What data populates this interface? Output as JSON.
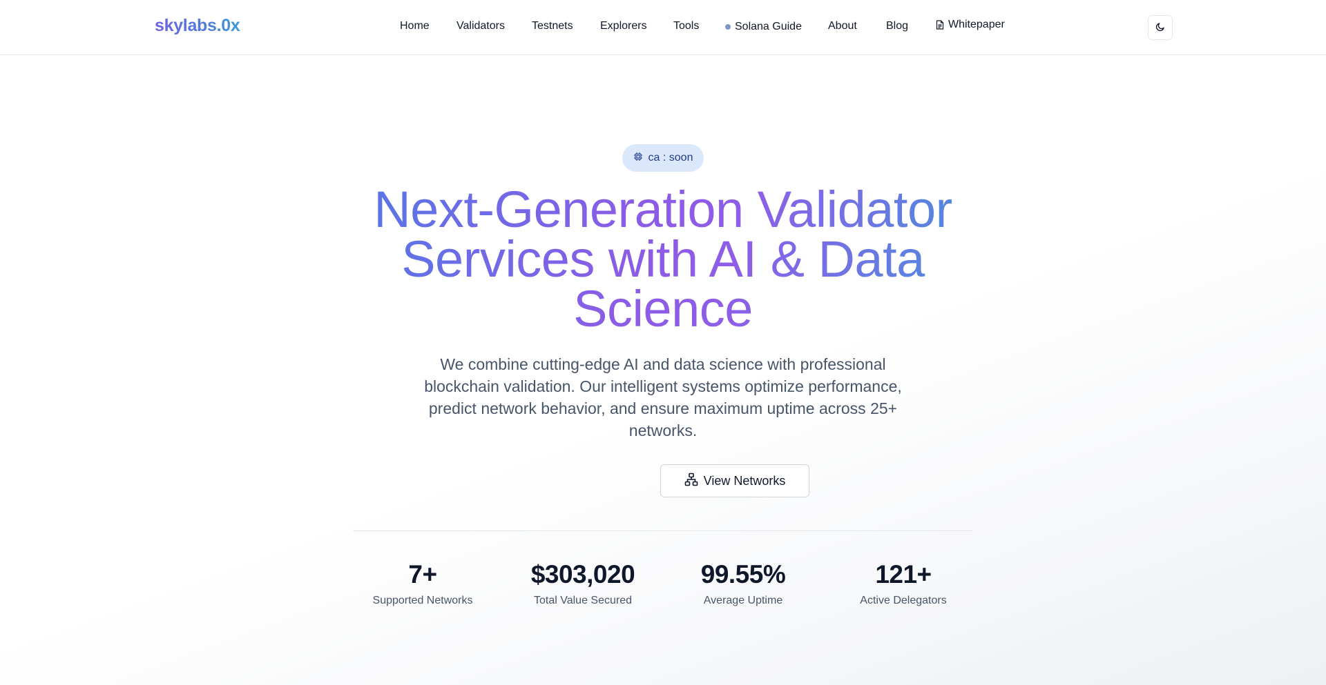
{
  "header": {
    "logo": "skylabs.0x",
    "nav": [
      {
        "label": "Home"
      },
      {
        "label": "Validators"
      },
      {
        "label": "Testnets"
      },
      {
        "label": "Explorers"
      },
      {
        "label": "Tools"
      },
      {
        "label": "Solana Guide",
        "icon": "status-dot"
      },
      {
        "label": "About"
      },
      {
        "label": "Blog"
      },
      {
        "label": "Whitepaper",
        "icon": "document-icon"
      }
    ],
    "theme_toggle_icon": "moon-icon"
  },
  "hero": {
    "badge": {
      "icon": "cpu-chip-icon",
      "text": "ca : soon"
    },
    "title": "Next-Generation Validator Services with AI & Data Science",
    "description": "We combine cutting-edge AI and data science with professional blockchain validation. Our intelligent systems optimize performance, predict network behavior, and ensure maximum uptime across 25+ networks.",
    "cta": {
      "icon": "network-icon",
      "label": "View Networks"
    }
  },
  "stats": [
    {
      "value": "7+",
      "label": "Supported Networks"
    },
    {
      "value": "$303,020",
      "label": "Total Value Secured"
    },
    {
      "value": "99.55%",
      "label": "Average Uptime"
    },
    {
      "value": "121+",
      "label": "Active Delegators"
    }
  ],
  "colors": {
    "brand_purple": "#8b5ce6",
    "brand_blue": "#4f7be6",
    "badge_bg": "#dbe8fb"
  }
}
